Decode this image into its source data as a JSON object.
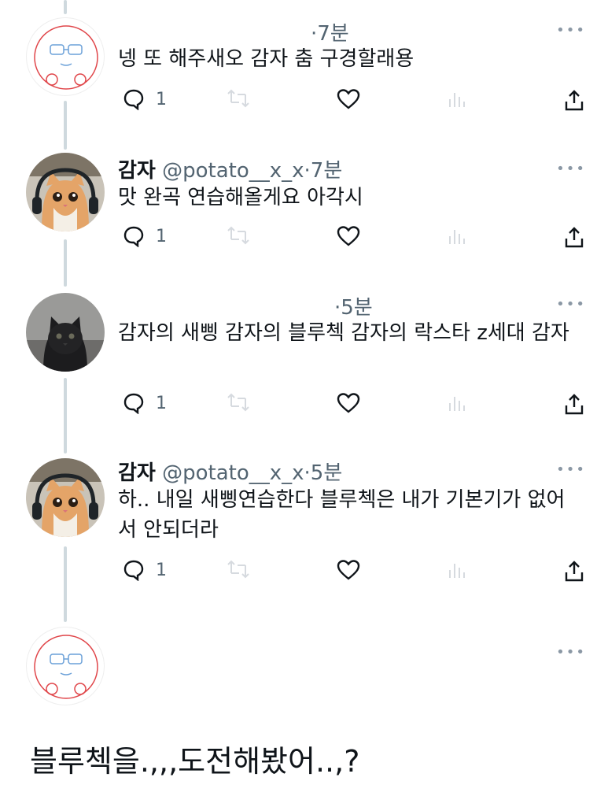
{
  "tweets": [
    {
      "avatar": "doodle-glasses-avatar",
      "name": "",
      "handle": "",
      "time": "·7분",
      "text": "넹 또 해주새오 감자 춤 구경할래용",
      "replies": "1"
    },
    {
      "avatar": "cat-headset-avatar",
      "name": "감자",
      "handle": "@potato__x_x",
      "time": "·7분",
      "text": "맛 완곡 연습해올게요 아각시",
      "replies": "1"
    },
    {
      "avatar": "black-kitten-avatar",
      "name": "",
      "handle": "",
      "time": "·5분",
      "text": "감자의 새삥 감자의 블루첵 감자의 락스타 z세대 감자",
      "replies": "1"
    },
    {
      "avatar": "cat-headset-avatar",
      "name": "감자",
      "handle": "@potato__x_x",
      "time": "·5분",
      "text": "하.. 내일 새삥연습한다 블루첵은 내가 기본기가 없어서 안되더라",
      "replies": "1"
    },
    {
      "avatar": "doodle-glasses-avatar",
      "name": "",
      "handle": "",
      "time": "",
      "text": "",
      "replies": ""
    }
  ],
  "more_label": "•••",
  "caption": "블루첵을.,,,도전해봤어..,?",
  "colors": {
    "text": "#0f1419",
    "secondary": "#536471",
    "thread_line": "#cfd9de",
    "doodle_red": "#e0464a",
    "doodle_blue": "#6aa0d8"
  },
  "icons": [
    "reply-icon",
    "retweet-icon",
    "like-icon",
    "views-icon",
    "share-icon",
    "more-icon"
  ]
}
